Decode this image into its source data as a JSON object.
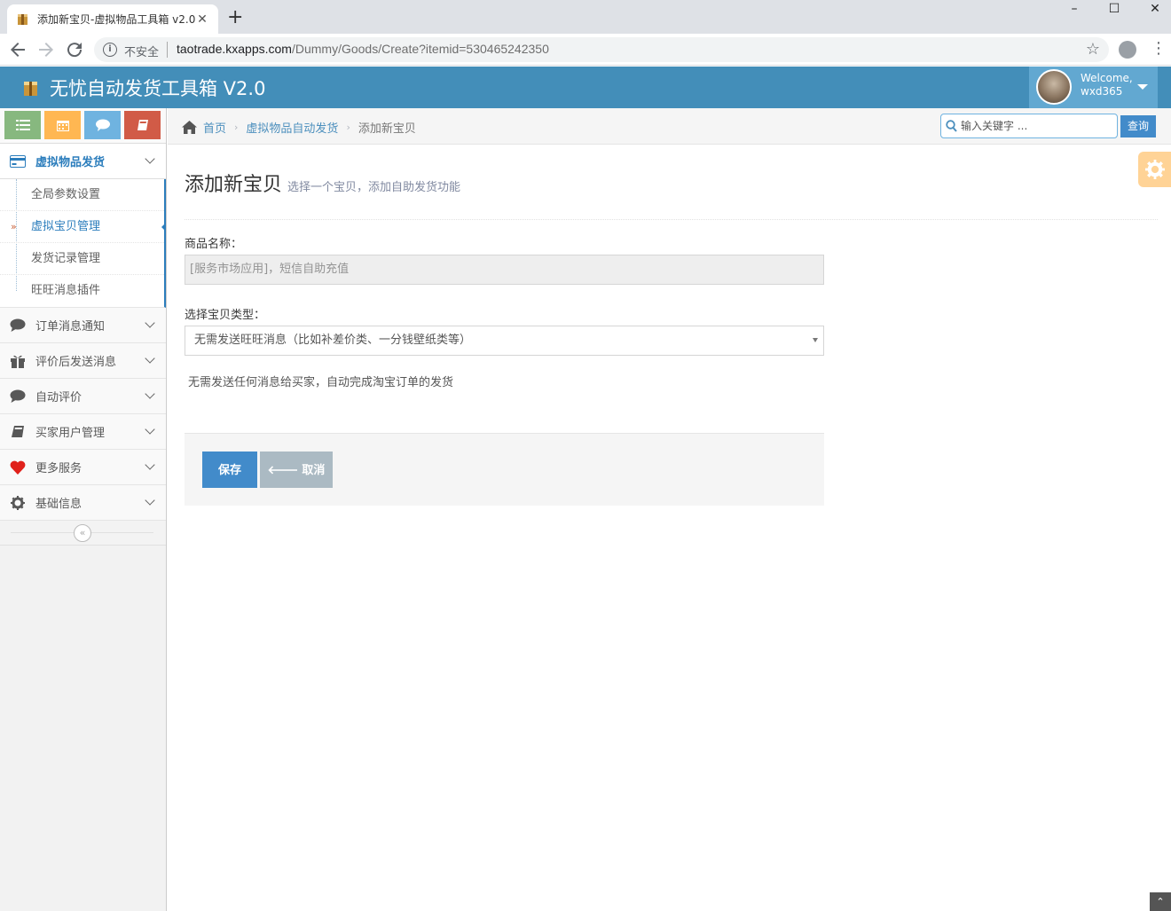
{
  "browser": {
    "tab_title": "添加新宝贝-虚拟物品工具箱 v2.0",
    "tab_close": "✕",
    "new_tab": "+",
    "insecure_label": "不安全",
    "url_host": "taotrade.kxapps.com",
    "url_path": "/Dummy/Goods/Create?itemid=530465242350",
    "win_minimize": "–",
    "win_maximize": "☐",
    "win_close": "✕"
  },
  "navbar": {
    "brand": "无忧自动发货工具箱 V2.0",
    "welcome": "Welcome,",
    "username": "wxd365"
  },
  "shortcuts": [
    {
      "icon": "list-icon",
      "color": "#87b87f"
    },
    {
      "icon": "calendar-icon",
      "color": "#ffb752"
    },
    {
      "icon": "comment-icon",
      "color": "#6fb3e0"
    },
    {
      "icon": "book-icon",
      "color": "#d15b47"
    }
  ],
  "sidebar": {
    "active_menu": {
      "label": "虚拟物品发货",
      "icon": "credit-card-icon"
    },
    "submenu": [
      {
        "label": "全局参数设置",
        "active": false
      },
      {
        "label": "虚拟宝贝管理",
        "active": true
      },
      {
        "label": "发货记录管理",
        "active": false
      },
      {
        "label": "旺旺消息插件",
        "active": false
      }
    ],
    "menus": [
      {
        "label": "订单消息通知",
        "icon": "comment-icon"
      },
      {
        "label": "评价后发送消息",
        "icon": "gift-icon"
      },
      {
        "label": "自动评价",
        "icon": "comment-icon"
      },
      {
        "label": "买家用户管理",
        "icon": "book-icon"
      },
      {
        "label": "更多服务",
        "icon": "heart-icon"
      },
      {
        "label": "基础信息",
        "icon": "gear-icon"
      }
    ],
    "collapse_glyph": "«"
  },
  "breadcrumbs": {
    "home": "首页",
    "section": "虚拟物品自动发货",
    "current": "添加新宝贝",
    "separator": "›"
  },
  "search": {
    "placeholder": "输入关键字 ...",
    "button": "查询"
  },
  "page": {
    "title": "添加新宝贝",
    "subtitle": "选择一个宝贝，添加自助发货功能"
  },
  "form": {
    "name_label": "商品名称：",
    "name_value": "[服务市场应用]，短信自助充值",
    "type_label": "选择宝贝类型：",
    "type_value": "无需发送旺旺消息（比如补差价类、一分钱壁纸类等）",
    "help_text": "无需发送任何消息给买家，自动完成淘宝订单的发货",
    "save_label": "保存",
    "cancel_label": "取消",
    "cancel_arrow": "🡐"
  },
  "scroll_up_glyph": "⌃"
}
